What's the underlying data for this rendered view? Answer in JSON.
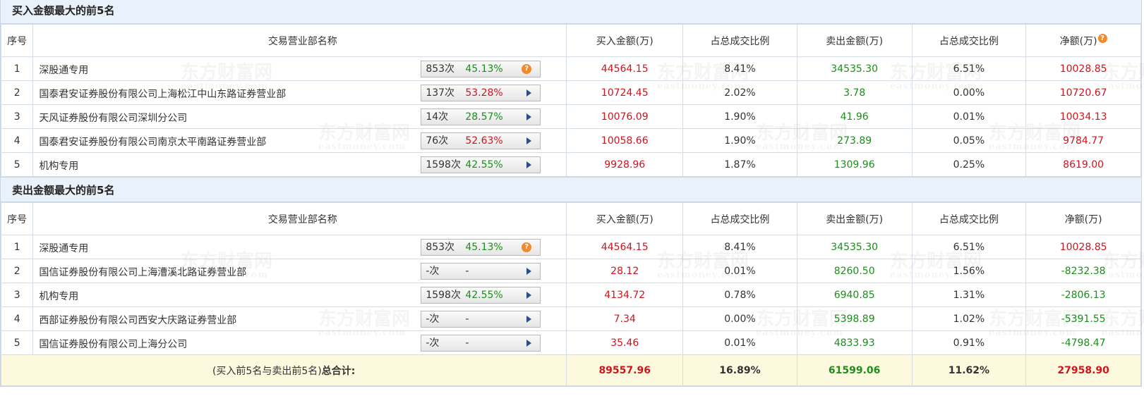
{
  "buy_section": {
    "title": "买入金额最大的前5名",
    "headers": {
      "idx": "序号",
      "name": "交易营业部名称",
      "buy": "买入金额(万)",
      "buy_pct": "占总成交比例",
      "sell": "卖出金额(万)",
      "sell_pct": "占总成交比例",
      "net": "净额(万)"
    },
    "rows": [
      {
        "idx": "1",
        "name": "深股通专用",
        "count": "853次",
        "rate": "45.13%",
        "rate_color": "green",
        "badge_icon": "question-icon",
        "buy": "44564.15",
        "buy_pct": "8.41%",
        "sell": "34535.30",
        "sell_pct": "6.51%",
        "net": "10028.85",
        "net_color": "red"
      },
      {
        "idx": "2",
        "name": "国泰君安证券股份有限公司上海松江中山东路证券营业部",
        "count": "137次",
        "rate": "53.28%",
        "rate_color": "red",
        "badge_icon": "arrow-right-icon",
        "buy": "10724.45",
        "buy_pct": "2.02%",
        "sell": "3.78",
        "sell_pct": "0.00%",
        "net": "10720.67",
        "net_color": "red"
      },
      {
        "idx": "3",
        "name": "天风证券股份有限公司深圳分公司",
        "count": "14次",
        "rate": "28.57%",
        "rate_color": "green",
        "badge_icon": "arrow-right-icon",
        "buy": "10076.09",
        "buy_pct": "1.90%",
        "sell": "41.96",
        "sell_pct": "0.01%",
        "net": "10034.13",
        "net_color": "red"
      },
      {
        "idx": "4",
        "name": "国泰君安证券股份有限公司南京太平南路证券营业部",
        "count": "76次",
        "rate": "52.63%",
        "rate_color": "red",
        "badge_icon": "arrow-right-icon",
        "buy": "10058.66",
        "buy_pct": "1.90%",
        "sell": "273.89",
        "sell_pct": "0.05%",
        "net": "9784.77",
        "net_color": "red"
      },
      {
        "idx": "5",
        "name": "机构专用",
        "count": "1598次",
        "rate": "42.55%",
        "rate_color": "green",
        "badge_icon": "arrow-right-icon",
        "buy": "9928.96",
        "buy_pct": "1.87%",
        "sell": "1309.96",
        "sell_pct": "0.25%",
        "net": "8619.00",
        "net_color": "red"
      }
    ]
  },
  "sell_section": {
    "title": "卖出金额最大的前5名",
    "headers": {
      "idx": "序号",
      "name": "交易营业部名称",
      "buy": "买入金额(万)",
      "buy_pct": "占总成交比例",
      "sell": "卖出金额(万)",
      "sell_pct": "占总成交比例",
      "net": "净额(万)"
    },
    "rows": [
      {
        "idx": "1",
        "name": "深股通专用",
        "count": "853次",
        "rate": "45.13%",
        "rate_color": "green",
        "badge_icon": "question-icon",
        "buy": "44564.15",
        "buy_pct": "8.41%",
        "sell": "34535.30",
        "sell_pct": "6.51%",
        "net": "10028.85",
        "net_color": "red"
      },
      {
        "idx": "2",
        "name": "国信证券股份有限公司上海漕溪北路证券营业部",
        "count": "-次",
        "rate": "-",
        "rate_color": "plain",
        "badge_icon": "arrow-right-icon",
        "buy": "28.12",
        "buy_pct": "0.01%",
        "sell": "8260.50",
        "sell_pct": "1.56%",
        "net": "-8232.38",
        "net_color": "green"
      },
      {
        "idx": "3",
        "name": "机构专用",
        "count": "1598次",
        "rate": "42.55%",
        "rate_color": "green",
        "badge_icon": "arrow-right-icon",
        "buy": "4134.72",
        "buy_pct": "0.78%",
        "sell": "6940.85",
        "sell_pct": "1.31%",
        "net": "-2806.13",
        "net_color": "green"
      },
      {
        "idx": "4",
        "name": "西部证券股份有限公司西安大庆路证券营业部",
        "count": "-次",
        "rate": "-",
        "rate_color": "plain",
        "badge_icon": "arrow-right-icon",
        "buy": "7.34",
        "buy_pct": "0.00%",
        "sell": "5398.89",
        "sell_pct": "1.02%",
        "net": "-5391.55",
        "net_color": "green"
      },
      {
        "idx": "5",
        "name": "国信证券股份有限公司上海分公司",
        "count": "-次",
        "rate": "-",
        "rate_color": "plain",
        "badge_icon": "arrow-right-icon",
        "buy": "35.46",
        "buy_pct": "0.01%",
        "sell": "4833.93",
        "sell_pct": "0.91%",
        "net": "-4798.47",
        "net_color": "green"
      }
    ]
  },
  "total": {
    "label_prefix": "(买入前5名与卖出前5名)",
    "label_bold": "总合计:",
    "buy": "89557.96",
    "buy_pct": "16.89%",
    "sell": "61599.06",
    "sell_pct": "11.62%",
    "net": "27958.90"
  },
  "watermark": {
    "cn": "东方财富网",
    "en": "eastmoney.com"
  },
  "colors": {
    "red": "#d0141c",
    "green": "#1a8f1a",
    "header_bg": "#e9f2fb",
    "total_bg": "#fdf9df",
    "border": "#d4dce6"
  }
}
